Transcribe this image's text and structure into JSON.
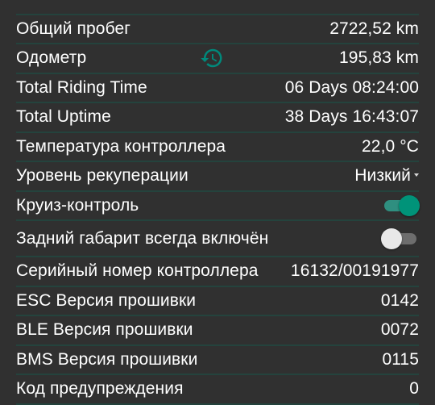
{
  "colors": {
    "background": "#303030",
    "divider": "#24433d",
    "accent": "#009379",
    "history_icon": "#00897b"
  },
  "rows": [
    {
      "label": "",
      "value": ""
    },
    {
      "label": "Общий пробег",
      "value": "2722,52 km"
    },
    {
      "label": "Одометр",
      "value": "195,83 km",
      "icon": "history-icon"
    },
    {
      "label": "Total Riding Time",
      "value": "06 Days 08:24:00"
    },
    {
      "label": "Total Uptime",
      "value": "38 Days 16:43:07"
    },
    {
      "label": "Температура контроллера",
      "value": "22,0 °C"
    },
    {
      "label": "Уровень рекуперации",
      "value": "Низкий"
    },
    {
      "label": "Круиз-контроль",
      "toggle": true
    },
    {
      "label": "Задний габарит всегда включён",
      "toggle": false
    },
    {
      "label": "Серийный номер контроллера",
      "value": "16132/00191977"
    },
    {
      "label": "ESC Версия прошивки",
      "value": "0142"
    },
    {
      "label": "BLE Версия прошивки",
      "value": "0072"
    },
    {
      "label": "BMS Версия прошивки",
      "value": "0115"
    },
    {
      "label": "Код предупреждения",
      "value": "0"
    }
  ]
}
